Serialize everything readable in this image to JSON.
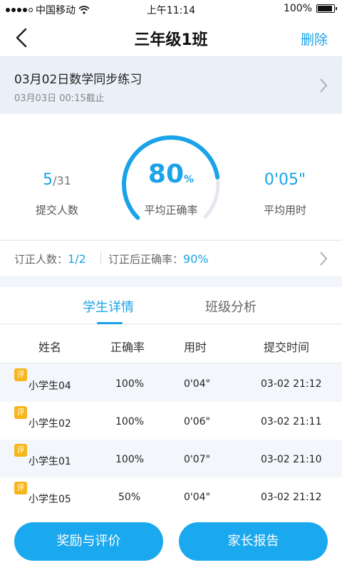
{
  "status_bar": {
    "carrier": "中国移动",
    "time": "上午11:14",
    "battery": "100%",
    "battery_level": 1.0
  },
  "nav": {
    "back_icon": "chevron-left-icon",
    "title": "三年级1班",
    "action": "删除"
  },
  "assignment": {
    "title": "03月02日数学同步练习",
    "deadline": "03月03日 00:15截止"
  },
  "stats": {
    "submitted": {
      "count": "5",
      "total": "/31",
      "label": "提交人数"
    },
    "accuracy": {
      "value": "80",
      "unit": "%",
      "label": "平均正确率",
      "fraction": 0.8
    },
    "time": {
      "value": "0'05\"",
      "label": "平均用时"
    }
  },
  "correction": {
    "count_label": "订正人数：",
    "count_value": "1/2",
    "accuracy_label": "订正后正确率：",
    "accuracy_value": "90%"
  },
  "tabs": [
    {
      "label": "学生详情",
      "active": true
    },
    {
      "label": "班级分析",
      "active": false
    }
  ],
  "table": {
    "headers": [
      "姓名",
      "正确率",
      "用时",
      "提交时间"
    ],
    "badge": "评",
    "rows": [
      {
        "name": "小学生04",
        "accuracy": "100%",
        "time": "0'04\"",
        "submitted": "03-02 21:12"
      },
      {
        "name": "小学生02",
        "accuracy": "100%",
        "time": "0'06\"",
        "submitted": "03-02 21:11"
      },
      {
        "name": "小学生01",
        "accuracy": "100%",
        "time": "0'07\"",
        "submitted": "03-02 21:10"
      },
      {
        "name": "小学生05",
        "accuracy": "50%",
        "time": "0'04\"",
        "submitted": "03-02 21:12"
      }
    ]
  },
  "footer": {
    "reward_button": "奖励与评价",
    "parent_report_button": "家长报告"
  },
  "colors": {
    "accent": "#1aa3e8",
    "badge": "#f5b51b"
  }
}
